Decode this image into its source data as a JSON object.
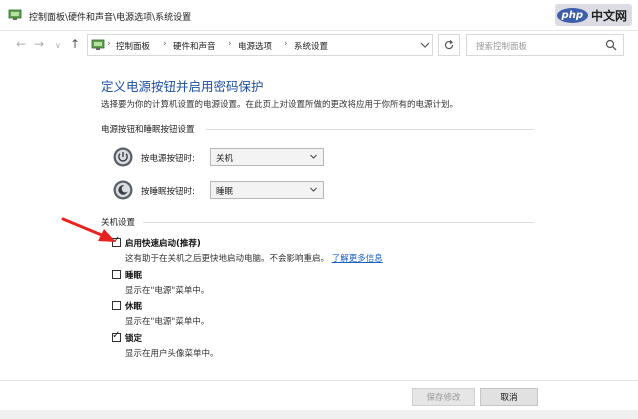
{
  "window": {
    "title": "控制面板\\硬件和声音\\电源选项\\系统设置"
  },
  "watermark": {
    "logo": "php",
    "text": "中文网"
  },
  "nav": {
    "back": "←",
    "forward": "→",
    "recent": "∨",
    "up": "↑"
  },
  "breadcrumb": {
    "items": [
      "控制面板",
      "硬件和声音",
      "电源选项",
      "系统设置"
    ],
    "separator": "›"
  },
  "search": {
    "placeholder": "搜索控制面板"
  },
  "page": {
    "title": "定义电源按钮并启用密码保护",
    "description": "选择要为你的计算机设置的电源设置。在此页上对设置所做的更改将应用于你所有的电源计划。"
  },
  "power_section": {
    "title": "电源按钮和睡眠按钮设置",
    "rows": [
      {
        "label": "按电源按钮时:",
        "value": "关机"
      },
      {
        "label": "按睡眠按钮时:",
        "value": "睡眠"
      }
    ]
  },
  "shutdown_section": {
    "title": "关机设置",
    "options": [
      {
        "label": "启用快速启动(推荐)",
        "checked": true,
        "desc": "这有助于在关机之后更快地启动电脑。不会影响重启。",
        "link": "了解更多信息"
      },
      {
        "label": "睡眠",
        "checked": false,
        "desc": "显示在\"电源\"菜单中。"
      },
      {
        "label": "休眠",
        "checked": false,
        "desc": "显示在\"电源\"菜单中。"
      },
      {
        "label": "锁定",
        "checked": true,
        "desc": "显示在用户头像菜单中。"
      }
    ]
  },
  "footer": {
    "save_label": "保存修改",
    "cancel_label": "取消"
  },
  "colors": {
    "title_blue": "#1c4ea0",
    "link_blue": "#1a5fc7",
    "arrow_red": "#e8231f"
  }
}
